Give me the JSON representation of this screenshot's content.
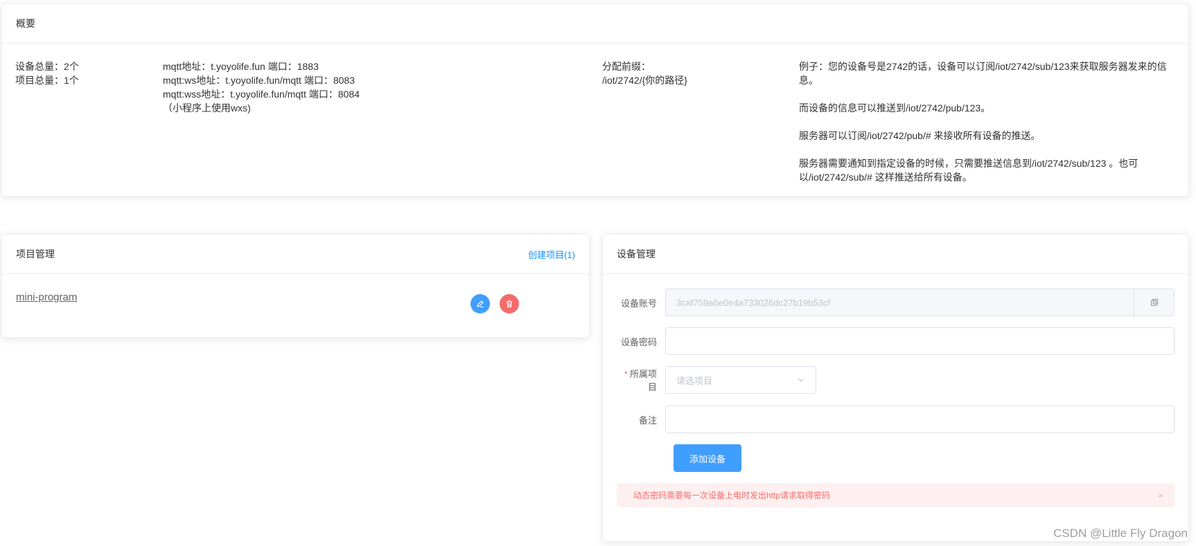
{
  "overview": {
    "title": "概要",
    "col1": [
      "设备总量：2个",
      "项目总量：1个"
    ],
    "col2": [
      "mqtt地址：t.yoyolife.fun 端口：1883",
      "mqtt:ws地址：t.yoyolife.fun/mqtt 端口：8083",
      "mqtt:wss地址：t.yoyolife.fun/mqtt 端口：8084",
      "（小程序上使用wxs)"
    ],
    "col3": [
      "分配前缀：",
      "/iot/2742/{你的路径}"
    ],
    "col4": [
      "例子：您的设备号是2742的话，设备可以订阅/iot/2742/sub/123来获取服务器发来的信息。",
      "而设备的信息可以推送到/iot/2742/pub/123。",
      "服务器可以订阅/iot/2742/pub/# 来接收所有设备的推送。",
      "服务器需要通知到指定设备的时候，只需要推送信息到/iot/2742/sub/123 。也可以/iot/2742/sub/# 这样推送给所有设备。"
    ]
  },
  "projects": {
    "title": "项目管理",
    "create_link": "创建项目(1)",
    "items": [
      {
        "name": "mini-program"
      }
    ]
  },
  "devices": {
    "title": "设备管理",
    "account_label": "设备账号",
    "account_value": "3caf759a6e0e4a733026dc27b19b53cf",
    "password_label": "设备密码",
    "password_value": "",
    "project_label": "所属项目",
    "project_required_mark": "*",
    "project_placeholder": "请选项目",
    "note_label": "备注",
    "note_value": "",
    "add_button": "添加设备",
    "alert_text": "动态密码需要每一次设备上电时发出http请求取得密码",
    "alert_close": "×"
  },
  "watermark": "CSDN @Little Fly Dragon",
  "colors": {
    "primary": "#409eff",
    "danger": "#f56c6c",
    "link": "#1890ff"
  }
}
